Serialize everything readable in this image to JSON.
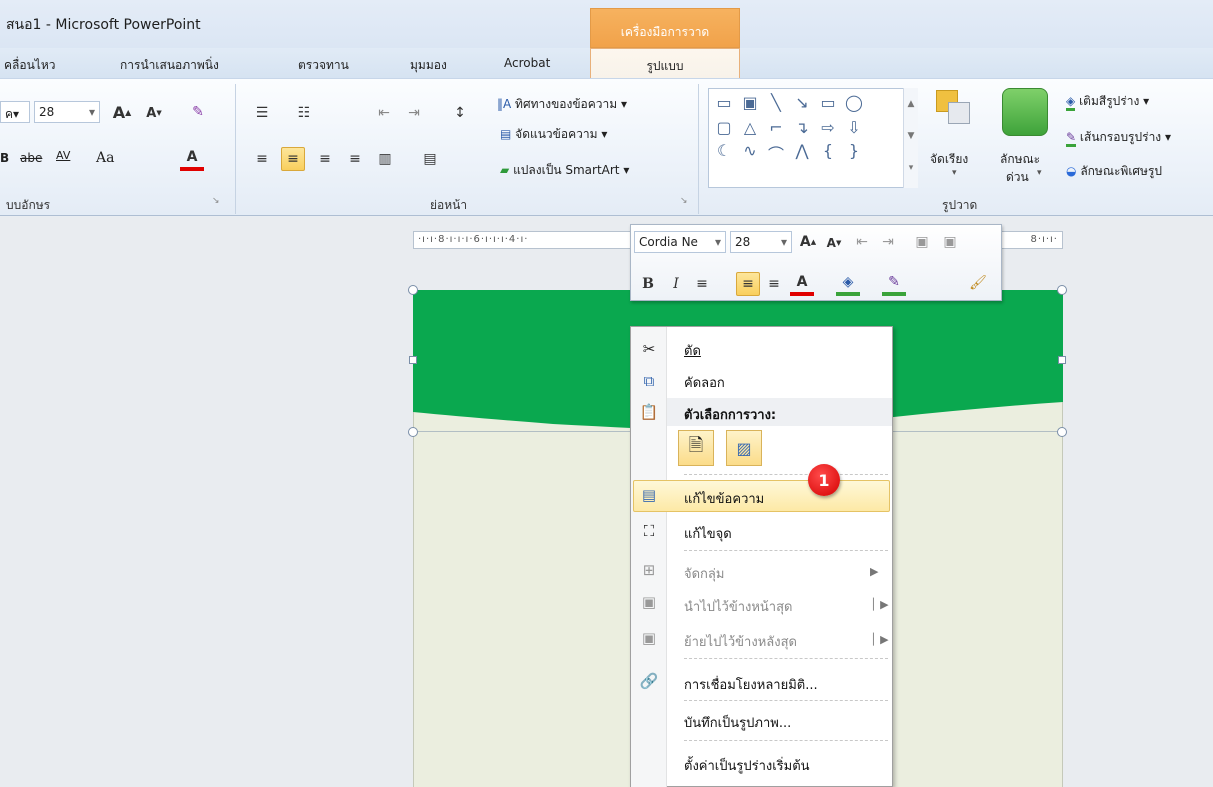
{
  "window": {
    "title": "สนอ1 - Microsoft PowerPoint",
    "context_tab_header": "เครื่องมือการวาด"
  },
  "tabs": [
    {
      "label": "คลื่อนไหว"
    },
    {
      "label": "การนำเสนอภาพนิ่ง"
    },
    {
      "label": "ตรวจทาน"
    },
    {
      "label": "มุมมอง"
    },
    {
      "label": "Acrobat"
    },
    {
      "label": "รูปแบบ"
    }
  ],
  "ribbon": {
    "font_size": "28",
    "font_group_label": "บบอักษร",
    "paragraph_group_label": "ย่อหน้า",
    "drawing_group_label": "รูปวาด",
    "text_direction": "ทิศทางของข้อความ",
    "align_text": "จัดแนวข้อความ",
    "convert_smartart": "แปลงเป็น SmartArt",
    "arrange": "จัดเรียง",
    "quick_styles_1": "ลักษณะ",
    "quick_styles_2": "ด่วน",
    "shape_fill": "เติมสีรูปร่าง",
    "shape_outline": "เส้นกรอบรูปร่าง",
    "shape_effects": "ลักษณะพิเศษรูป",
    "strike_label": "abe",
    "spacing_label": "AV",
    "case_label": "Aa"
  },
  "ruler": {
    "text": "·ı·ı·8·ı·ı·ı·6·ı·ı·ı·4·ı·"
  },
  "ruler_right": {
    "text": "8·ı·ı·"
  },
  "mini_toolbar": {
    "font_name": "Cordia Ne",
    "font_size": "28"
  },
  "context_menu": {
    "cut": "ตัด",
    "copy": "คัดลอก",
    "paste_options": "ตัวเลือกการวาง:",
    "edit_text": "แก้ไขข้อความ",
    "edit_points": "แก้ไขจุด",
    "group": "จัดกลุ่ม",
    "bring_to_front": "นำไปไว้ข้างหน้าสุด",
    "send_to_back": "ย้ายไปไว้ข้างหลังสุด",
    "hyperlink": "การเชื่อมโยงหลายมิติ...",
    "save_as_picture": "บันทึกเป็นรูปภาพ...",
    "set_default_shape": "ตั้งค่าเป็นรูปร่างเริ่มต้น"
  },
  "badge": {
    "number": "1"
  },
  "colors": {
    "banner_green": "#0aa84f",
    "slide_bg": "#ebeedf",
    "accent_orange": "#f1a24a",
    "badge_red": "#d40000"
  }
}
